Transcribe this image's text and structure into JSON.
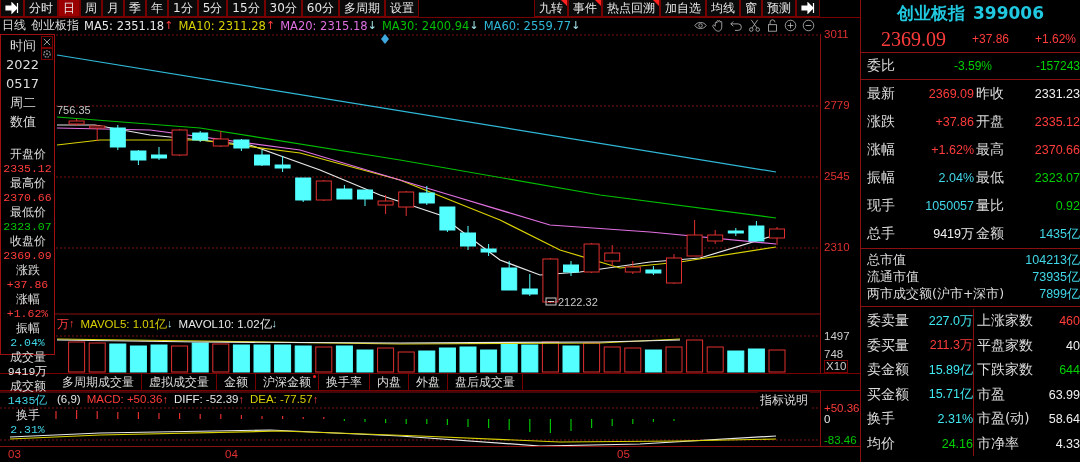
{
  "toolbar": {
    "left": [
      {
        "label": "分时",
        "selected": false
      },
      {
        "label": "日",
        "selected": true
      },
      {
        "label": "周",
        "selected": false
      },
      {
        "label": "月",
        "selected": false
      },
      {
        "label": "季",
        "selected": false
      },
      {
        "label": "年",
        "selected": false
      },
      {
        "label": "1分",
        "selected": false
      },
      {
        "label": "5分",
        "selected": false
      },
      {
        "label": "15分",
        "selected": false
      },
      {
        "label": "30分",
        "selected": false
      },
      {
        "label": "60分",
        "selected": false
      },
      {
        "label": "多周期",
        "selected": false
      },
      {
        "label": "设置",
        "selected": false
      }
    ],
    "right": [
      {
        "label": "九转",
        "flagged": true
      },
      {
        "label": "事件",
        "flagged": true
      },
      {
        "label": "热点回溯",
        "flagged": true
      },
      {
        "label": "加自选",
        "flagged": false
      },
      {
        "label": "均线",
        "flagged": false
      },
      {
        "label": "窗",
        "flagged": false
      },
      {
        "label": "预测",
        "flagged": false
      }
    ]
  },
  "legend": {
    "period": "日线",
    "name": "创业板指",
    "items": [
      {
        "text": "MA5: 2351.18",
        "arrow": "↑",
        "rising": true
      },
      {
        "text": "MA10: 2311.28",
        "arrow": "↑",
        "rising": true
      },
      {
        "text": "MA20: 2315.18",
        "arrow": "↓",
        "rising": false
      },
      {
        "text": "MA30: 2400.94",
        "arrow": "↓",
        "rising": false
      },
      {
        "text": "MA60: 2559.77",
        "arrow": "↓",
        "rising": false
      }
    ]
  },
  "info_panel": {
    "header": [
      "时间",
      "2022",
      "0517",
      "周二",
      "数值"
    ],
    "fields": [
      {
        "label": "开盘价",
        "value": "2335.12",
        "color": "#ff3c3c"
      },
      {
        "label": "最高价",
        "value": "2370.66",
        "color": "#ff3c3c"
      },
      {
        "label": "最低价",
        "value": "2323.07",
        "color": "#00c800"
      },
      {
        "label": "收盘价",
        "value": "2369.09",
        "color": "#ff3c3c"
      },
      {
        "label": "涨跌",
        "value": "+37.86",
        "color": "#ff3c3c"
      },
      {
        "label": "涨幅",
        "value": "+1.62%",
        "color": "#ff3c3c"
      },
      {
        "label": "振幅",
        "value": "2.04%",
        "color": "#40d8e8"
      },
      {
        "label": "成交量",
        "value": "9419万",
        "color": "#e8e8e8"
      },
      {
        "label": "成交额",
        "value": "1435亿",
        "color": "#40d8e8"
      },
      {
        "label": "换手",
        "value": "2.31%",
        "color": "#40d8e8"
      }
    ]
  },
  "price_chart": {
    "axis": [
      "3011",
      "2779",
      "2545",
      "2310"
    ],
    "high_label": "756.35",
    "low_label": "2122.32"
  },
  "volume": {
    "header": [
      {
        "text": "万",
        "arrow": "↑",
        "rising": true
      },
      {
        "text": "MAVOL5: 1.01亿",
        "arrow": "↓",
        "rising": false
      },
      {
        "text": "MAVOL10: 1.02亿",
        "arrow": "↓",
        "rising": false
      }
    ],
    "axis": [
      "1497",
      "748"
    ],
    "scale": "X10"
  },
  "indicator_tabs": [
    {
      "label": "多周期成交量",
      "flagged": false
    },
    {
      "label": "虚拟成交量",
      "flagged": false
    },
    {
      "label": "金额",
      "flagged": false
    },
    {
      "label": "沪深金额",
      "flagged": true
    },
    {
      "label": "换手率",
      "flagged": false
    },
    {
      "label": "内盘",
      "flagged": false
    },
    {
      "label": "外盘",
      "flagged": false
    },
    {
      "label": "盘后成交量",
      "flagged": false
    }
  ],
  "macd": {
    "header": [
      {
        "text": "(6,9)"
      },
      {
        "text": "MACD: +50.36",
        "arrow": "↑",
        "rising": true
      },
      {
        "text": "DIFF: -52.39",
        "arrow": "↑",
        "rising": true
      },
      {
        "text": "DEA: -77.57",
        "arrow": "↑",
        "rising": true
      }
    ],
    "help_button": "指标说明",
    "axis": [
      "+50.36",
      "0",
      "-83.46"
    ]
  },
  "dates": [
    "03",
    "04",
    "05"
  ],
  "quote": {
    "name": "创业板指",
    "code": "399006",
    "price": "2369.09",
    "change": "+37.86",
    "change_pct": "+1.62%"
  },
  "order_ratio": {
    "label": "委比",
    "pct": "-3.59%",
    "diff": "-157243"
  },
  "stats": [
    {
      "label": "最新",
      "value": "2369.09",
      "color": "#ff3c3c"
    },
    {
      "label": "昨收",
      "value": "2331.23",
      "color": "#f0f0f0"
    },
    {
      "label": "涨跌",
      "value": "+37.86",
      "color": "#ff3c3c"
    },
    {
      "label": "开盘",
      "value": "2335.12",
      "color": "#ff3c3c"
    },
    {
      "label": "涨幅",
      "value": "+1.62%",
      "color": "#ff3c3c"
    },
    {
      "label": "最高",
      "value": "2370.66",
      "color": "#ff3c3c"
    },
    {
      "label": "振幅",
      "value": "2.04%",
      "color": "#40d8e8"
    },
    {
      "label": "最低",
      "value": "2323.07",
      "color": "#00d000"
    },
    {
      "label": "现手",
      "value": "1050057",
      "color": "#40d8e8"
    },
    {
      "label": "量比",
      "value": "0.92",
      "color": "#00d000"
    },
    {
      "label": "总手",
      "value": "9419万",
      "color": "#f0f0f0"
    },
    {
      "label": "金额",
      "value": "1435亿",
      "color": "#40d8e8"
    }
  ],
  "market": [
    {
      "label": "总市值",
      "value": "104213亿"
    },
    {
      "label": "流通市值",
      "value": "73935亿"
    },
    {
      "label": "两市成交额(沪市+深市)",
      "value": "7899亿"
    }
  ],
  "trading": [
    {
      "label": "委卖量",
      "value": "227.0万",
      "color": "#40e8f0"
    },
    {
      "label": "上涨家数",
      "value": "460",
      "color": "#ff3c3c"
    },
    {
      "label": "委买量",
      "value": "211.3万",
      "color": "#ff3c3c"
    },
    {
      "label": "平盘家数",
      "value": "40",
      "color": "#f0f0f0"
    },
    {
      "label": "卖金额",
      "value": "15.89亿",
      "color": "#40e8f0"
    },
    {
      "label": "下跌家数",
      "value": "644",
      "color": "#00d000"
    },
    {
      "label": "买金额",
      "value": "15.71亿",
      "color": "#40e8f0"
    },
    {
      "label": "市盈",
      "value": "63.99",
      "color": "#f0f0f0"
    },
    {
      "label": "换手",
      "value": "2.31%",
      "color": "#40e8f0"
    },
    {
      "label": "市盈(动)",
      "value": "58.64",
      "color": "#f0f0f0"
    },
    {
      "label": "均价",
      "value": "24.16",
      "color": "#00d000"
    },
    {
      "label": "市净率",
      "value": "4.33",
      "color": "#f0f0f0"
    }
  ]
}
